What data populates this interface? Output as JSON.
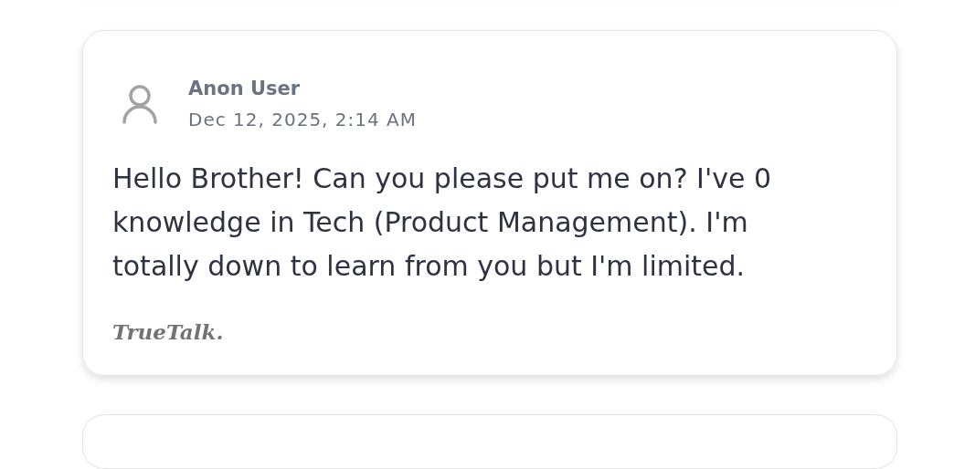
{
  "post": {
    "author": "Anon User",
    "timestamp": "Dec 12, 2025, 2:14 AM",
    "message": "Hello Brother! Can you please put me on? I've 0 knowledge in Tech (Product Management). I'm totally down to learn from you but I'm limited.",
    "brand": "TrueTalk."
  }
}
